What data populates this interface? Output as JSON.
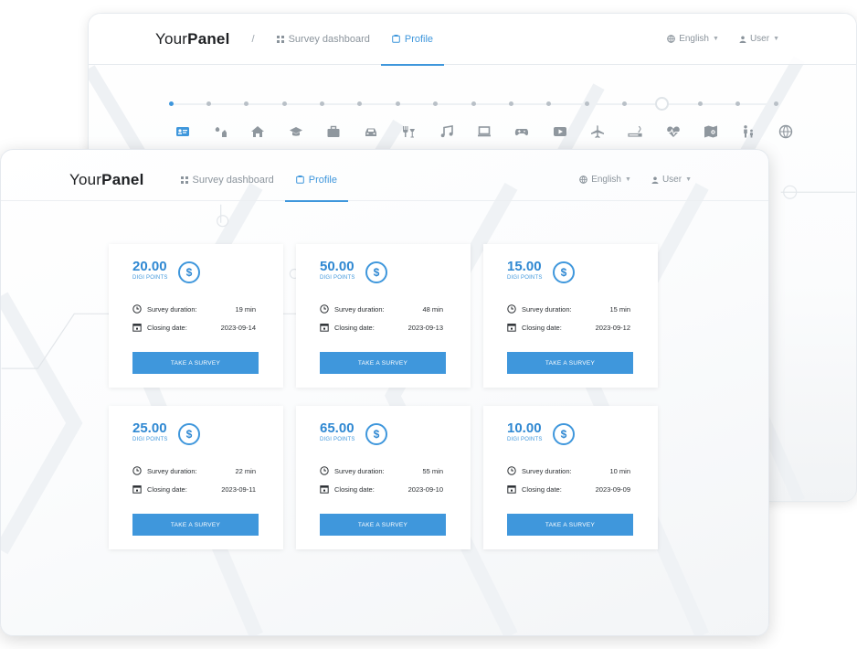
{
  "brand": {
    "name_prefix": "Your",
    "name_bold": "Panel"
  },
  "back_window": {
    "breadcrumb_sep": "/",
    "nav": {
      "dashboard": "Survey dashboard",
      "profile": "Profile"
    },
    "language": "English",
    "user": "User",
    "progress": {
      "completed_steps": 1,
      "total_steps": 17
    },
    "categories": [
      "id-card-icon",
      "garden-icon",
      "home-icon",
      "education-icon",
      "work-icon",
      "car-icon",
      "food-drink-icon",
      "music-icon",
      "computer-icon",
      "gaming-icon",
      "video-icon",
      "travel-icon",
      "smoking-icon",
      "health-icon",
      "maps-icon",
      "family-icon",
      "globe-icon"
    ]
  },
  "front_window": {
    "nav": {
      "dashboard": "Survey dashboard",
      "profile": "Profile"
    },
    "language": "English",
    "user": "User"
  },
  "labels": {
    "points_unit": "DIGI POINTS",
    "duration": "Survey duration:",
    "closing": "Closing date:",
    "button": "TAKE A SURVEY"
  },
  "surveys": [
    {
      "points": "20.00",
      "duration": "19 min",
      "closing": "2023-09-14"
    },
    {
      "points": "50.00",
      "duration": "48 min",
      "closing": "2023-09-13"
    },
    {
      "points": "15.00",
      "duration": "15 min",
      "closing": "2023-09-12"
    },
    {
      "points": "25.00",
      "duration": "22 min",
      "closing": "2023-09-11"
    },
    {
      "points": "65.00",
      "duration": "55 min",
      "closing": "2023-09-10"
    },
    {
      "points": "10.00",
      "duration": "10 min",
      "closing": "2023-09-09"
    }
  ],
  "colors": {
    "accent": "#3f97dc",
    "accent_dark": "#2f88d2",
    "icon_gray": "#8f979e"
  }
}
